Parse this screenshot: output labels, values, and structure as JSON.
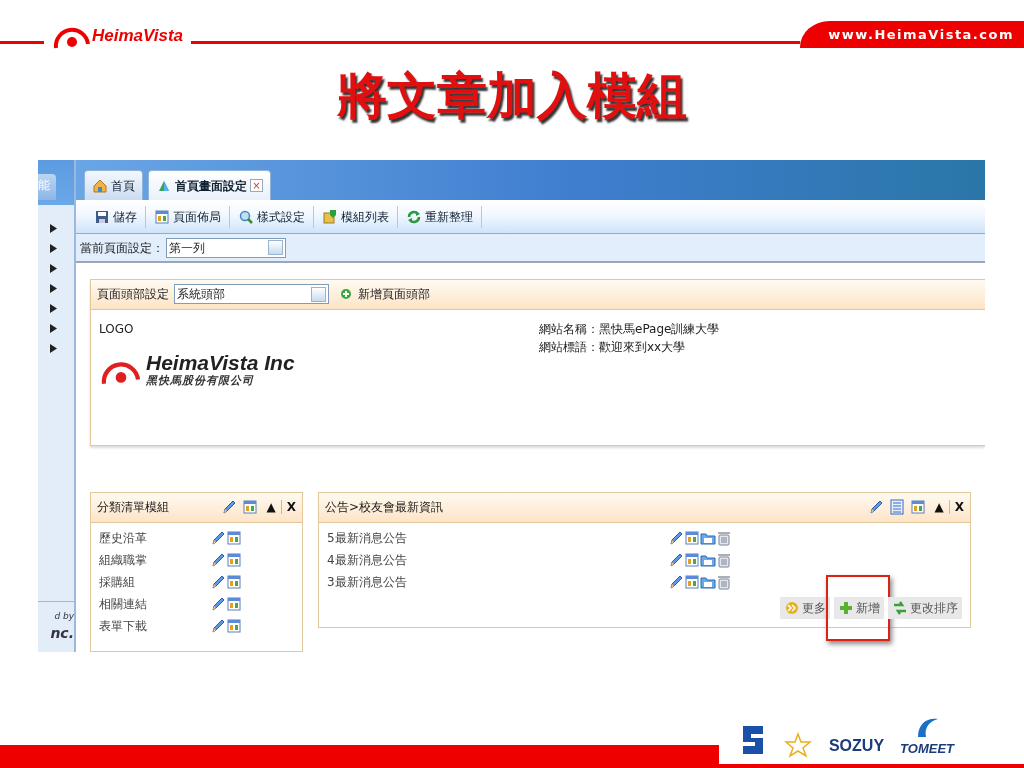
{
  "slide": {
    "brand": "HeimaVista",
    "url": "www.HeimaVista.com",
    "title": "將文章加入模組",
    "footer_logos": [
      "SOZUY",
      "TOMEET"
    ]
  },
  "app": {
    "sidebar": {
      "tab": "能",
      "footer": [
        "d by",
        "nc."
      ]
    },
    "tabs": [
      {
        "label": "首頁",
        "selected": false
      },
      {
        "label": "首頁畫面設定",
        "selected": true,
        "close": "×"
      }
    ],
    "toolbar": [
      {
        "label": "儲存"
      },
      {
        "label": "頁面佈局"
      },
      {
        "label": "樣式設定"
      },
      {
        "label": "模組列表"
      },
      {
        "label": "重新整理"
      }
    ],
    "page_setting": {
      "label": "當前頁面設定：",
      "value": "第一列"
    },
    "header_panel": {
      "label": "頁面頭部設定",
      "value": "系統頭部",
      "add_link": "新增頁面頭部",
      "logo_label": "LOGO",
      "logo_name": "HeimaVista Inc",
      "logo_sub": "黑快馬股份有限公司",
      "site_info": [
        "網站名稱：黑快馬ePage訓練大學",
        "網站標語：歡迎來到xx大學"
      ]
    },
    "modules": [
      {
        "kind": "category",
        "title": "分類清單模組",
        "up": "▲",
        "close": "X",
        "items": [
          {
            "label": "歷史沿革"
          },
          {
            "label": "組織職掌"
          },
          {
            "label": "採購組"
          },
          {
            "label": "相關連結"
          },
          {
            "label": "表單下載"
          }
        ]
      },
      {
        "kind": "articles",
        "title": "公告>校友會最新資訊",
        "up": "▲",
        "close": "X",
        "items": [
          {
            "label": "5最新消息公告"
          },
          {
            "label": "4最新消息公告"
          },
          {
            "label": "3最新消息公告"
          }
        ],
        "buttons": [
          {
            "label": "更多",
            "highlighted": false
          },
          {
            "label": "新增",
            "highlighted": true
          },
          {
            "label": "更改排序",
            "highlighted": false
          }
        ]
      }
    ]
  }
}
